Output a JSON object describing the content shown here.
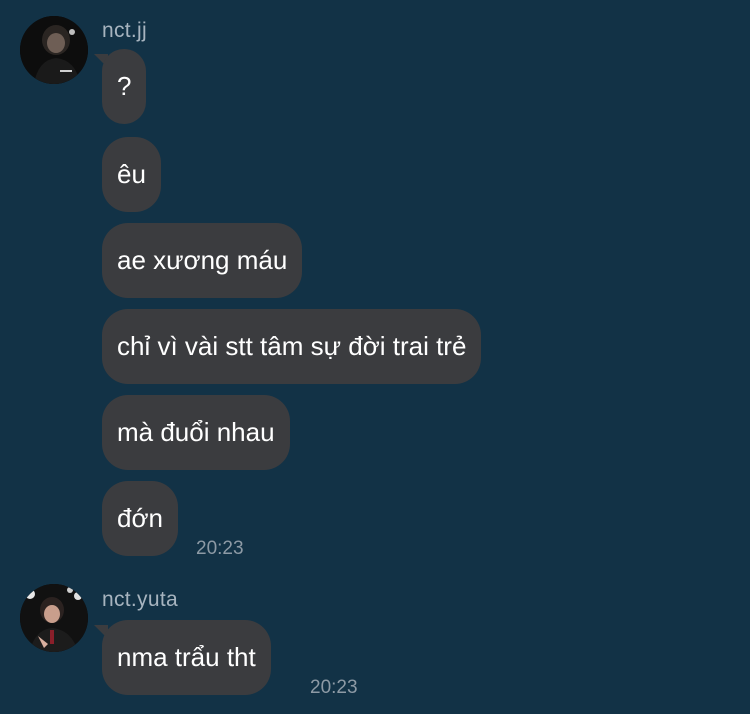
{
  "chat": {
    "groups": [
      {
        "sender": "nct.jj",
        "avatar_icon": "user-avatar-photo",
        "messages": [
          {
            "text": "?"
          },
          {
            "text": "êu"
          },
          {
            "text": "ae xương máu"
          },
          {
            "text": "chỉ vì vài stt tâm sự đời trai trẻ"
          },
          {
            "text": "mà đuổi nhau"
          },
          {
            "text": "đớn",
            "time": "20:23"
          }
        ]
      },
      {
        "sender": "nct.yuta",
        "avatar_icon": "user-avatar-photo",
        "messages": [
          {
            "text": "nma trẩu tht",
            "time": "20:23"
          }
        ]
      }
    ]
  },
  "colors": {
    "background": "#123246",
    "bubble": "#3b3c3f",
    "sender_text": "#a7b4bf",
    "timestamp_text": "#8d9aa5"
  }
}
